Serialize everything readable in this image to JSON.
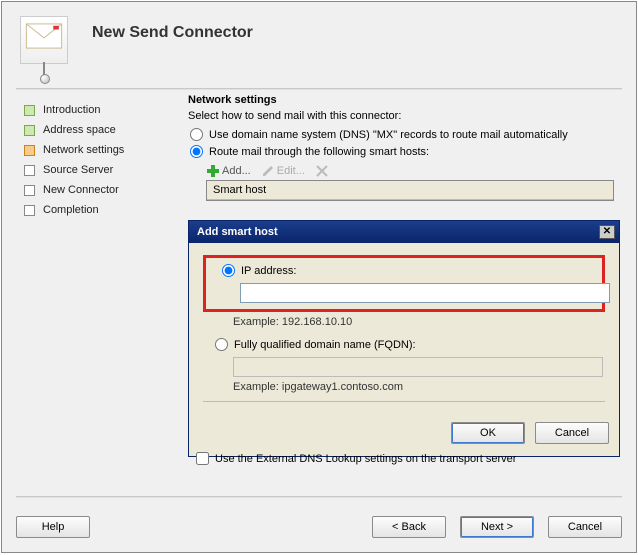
{
  "title": "New Send Connector",
  "sidebar": {
    "items": [
      {
        "label": "Introduction",
        "state": "done"
      },
      {
        "label": "Address space",
        "state": "done"
      },
      {
        "label": "Network settings",
        "state": "active"
      },
      {
        "label": "Source Server",
        "state": "pending"
      },
      {
        "label": "New Connector",
        "state": "pending"
      },
      {
        "label": "Completion",
        "state": "pending"
      }
    ]
  },
  "main": {
    "section_title": "Network settings",
    "desc": "Select how to send mail with this connector:",
    "radio_dns": "Use domain name system (DNS) \"MX\" records to route mail automatically",
    "radio_smarthost": "Route mail through the following smart hosts:",
    "selected_radio": "smarthost",
    "tools": {
      "add": "Add...",
      "edit": "Edit...",
      "remove_icon": "delete-icon"
    },
    "grid_header": "Smart host",
    "checkbox": "Use the External DNS Lookup settings on the transport server",
    "checkbox_checked": false
  },
  "dialog": {
    "title": "Add smart host",
    "opt_ip": "IP address:",
    "opt_fqdn": "Fully qualified domain name (FQDN):",
    "selected": "ip",
    "ip_value": "",
    "ip_example": "Example: 192.168.10.10",
    "fqdn_value": "",
    "fqdn_example": "Example: ipgateway1.contoso.com",
    "ok": "OK",
    "cancel": "Cancel"
  },
  "buttons": {
    "help": "Help",
    "back": "< Back",
    "next": "Next >",
    "cancel": "Cancel"
  }
}
